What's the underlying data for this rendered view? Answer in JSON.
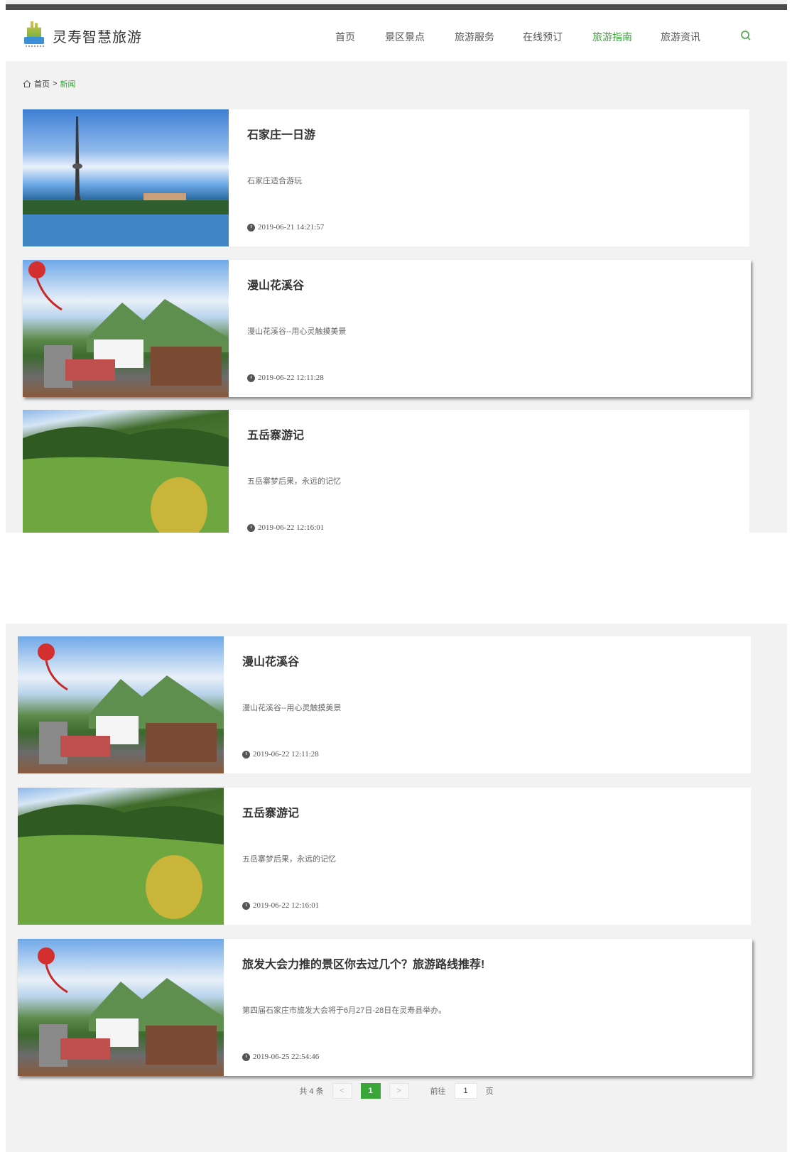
{
  "header": {
    "site_title": "灵寿智慧旅游",
    "nav": [
      {
        "label": "首页"
      },
      {
        "label": "景区景点"
      },
      {
        "label": "旅游服务"
      },
      {
        "label": "在线预订"
      },
      {
        "label": "旅游指南",
        "active": true
      },
      {
        "label": "旅游资讯"
      }
    ],
    "accent_color": "#3aa63a"
  },
  "breadcrumb": {
    "home": "首页",
    "separator": ">",
    "current": "新闻"
  },
  "articles_top": [
    {
      "title": "石家庄一日游",
      "desc": "石家庄适合游玩",
      "date": "2019-06-21 14:21:57",
      "image": "tv-tower-lake"
    },
    {
      "title": "漫山花溪谷",
      "desc": "漫山花溪谷--用心灵触摸美景",
      "date": "2019-06-22 12:11:28",
      "image": "valley-gate"
    },
    {
      "title": "五岳寨游记",
      "desc": "五岳寨梦后果，永远的记忆",
      "date": "2019-06-22 12:16:01",
      "image": "green-hills"
    }
  ],
  "articles_bottom": [
    {
      "title": "漫山花溪谷",
      "desc": "漫山花溪谷--用心灵触摸美景",
      "date": "2019-06-22 12:11:28",
      "image": "valley-gate"
    },
    {
      "title": "五岳寨游记",
      "desc": "五岳寨梦后果，永远的记忆",
      "date": "2019-06-22 12:16:01",
      "image": "green-hills"
    },
    {
      "title": "旅发大会力推的景区你去过几个？旅游路线推荐!",
      "desc": "第四届石家庄市旅发大会将于6月27日-28日在灵寿县举办。",
      "date": "2019-06-25 22:54:46",
      "image": "valley-gate"
    }
  ],
  "pagination": {
    "total": "共 4 条",
    "prev": "<",
    "current": "1",
    "next": ">",
    "goto": "前往",
    "page_input": "1",
    "page_suffix": "页"
  }
}
